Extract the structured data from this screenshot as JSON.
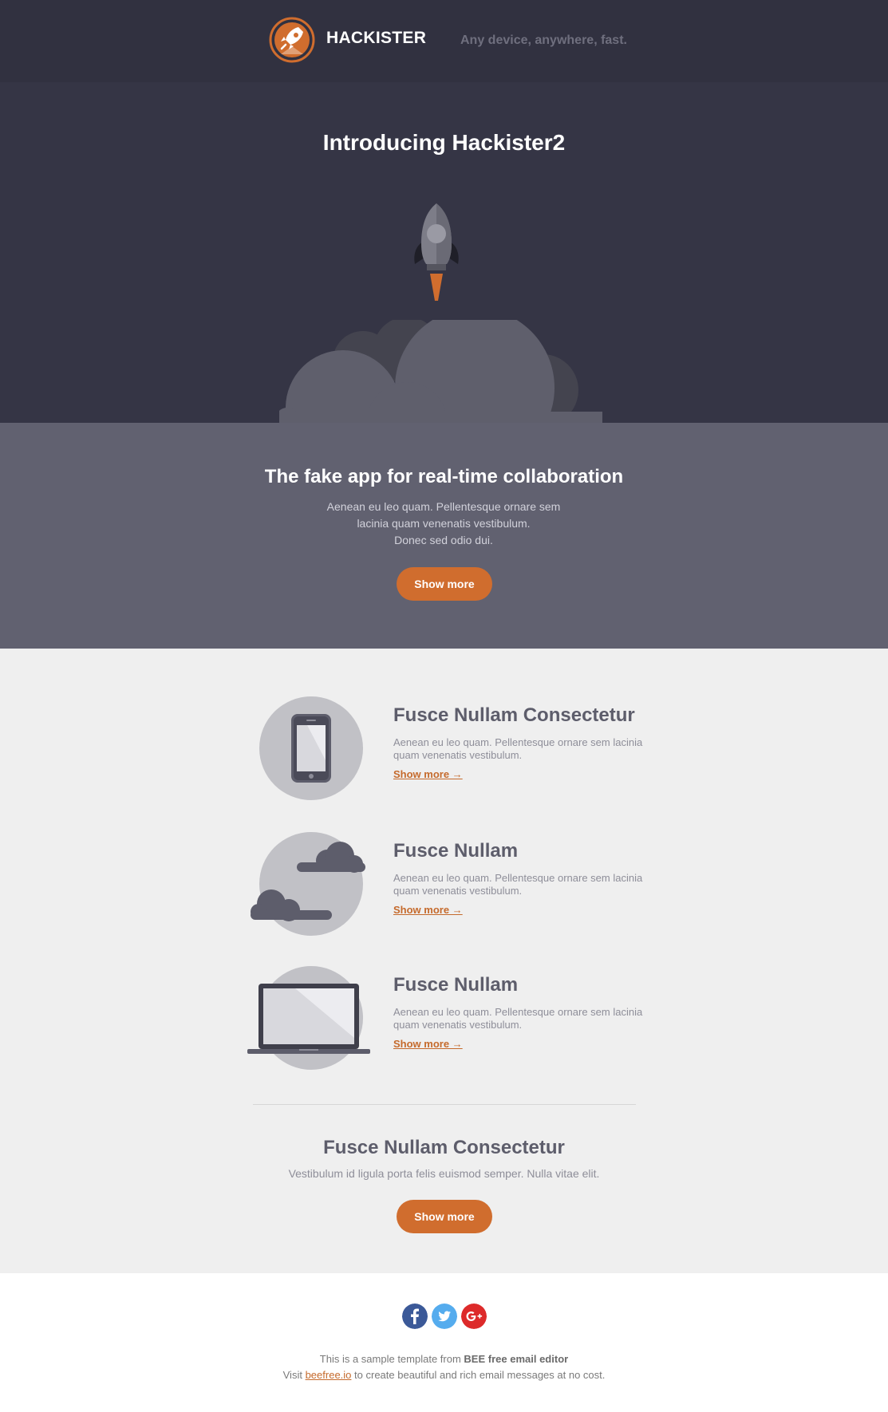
{
  "header": {
    "brand": "HACKISTER",
    "tagline": "Any device, anywhere, fast."
  },
  "hero": {
    "title": "Introducing Hackister2"
  },
  "intro": {
    "title": "The fake app for real-time collaboration",
    "line1": "Aenean eu leo quam. Pellentesque ornare sem",
    "line2": "lacinia quam venenatis vestibulum.",
    "line3": "Donec sed odio dui.",
    "button": "Show more"
  },
  "features": [
    {
      "icon": "smartphone-icon",
      "title": "Fusce Nullam Consectetur",
      "text": "Aenean eu leo quam. Pellentesque ornare sem lacinia quam venenatis vestibulum.",
      "link": "Show more →"
    },
    {
      "icon": "cloud-icon",
      "title": "Fusce Nullam",
      "text": "Aenean eu leo quam. Pellentesque ornare sem lacinia quam venenatis vestibulum.",
      "link": "Show more →"
    },
    {
      "icon": "laptop-icon",
      "title": "Fusce Nullam",
      "text": "Aenean eu leo quam. Pellentesque ornare sem lacinia quam venenatis vestibulum.",
      "link": "Show more →"
    }
  ],
  "bottom": {
    "title": "Fusce Nullam Consectetur",
    "text": "Vestibulum id ligula porta felis euismod semper. Nulla vitae elit.",
    "button": "Show more"
  },
  "footer": {
    "social": [
      {
        "icon": "facebook-icon",
        "glyph": "f",
        "color": "#3b5998"
      },
      {
        "icon": "twitter-icon",
        "glyph": "t",
        "color": "#55acee"
      },
      {
        "icon": "google-plus-icon",
        "glyph": "G+",
        "color": "#dd2a2a"
      }
    ],
    "line1_prefix": "This is a sample template from",
    "line1_bold": "BEE free email editor",
    "line2_prefix": "Visit",
    "line2_link": "beefree.io",
    "line2_suffix": "to create beautiful and rich email messages at no cost."
  },
  "colors": {
    "accent": "#d06d2e",
    "dark": "#313140",
    "band": "#616170"
  }
}
